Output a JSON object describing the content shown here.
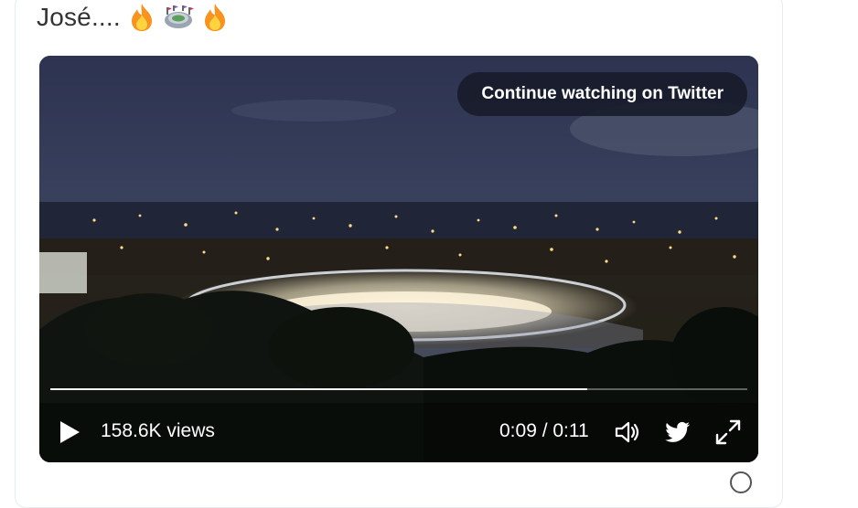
{
  "tweet": {
    "text": "José....",
    "emojis": [
      "fire-emoji",
      "stadium-emoji",
      "fire-emoji"
    ]
  },
  "video": {
    "continue_label": "Continue watching on Twitter",
    "views": "158.6K views",
    "time": "0:09 / 0:11",
    "progress": 0.77
  },
  "colors": {
    "accent": "#ffffff",
    "overlay": "#161a28",
    "sky": "#2b3046"
  },
  "icons": {
    "play": "play-icon",
    "mute": "volume-icon",
    "twitter": "twitter-bird-icon",
    "fullscreen": "fullscreen-icon",
    "info": "info-icon"
  }
}
